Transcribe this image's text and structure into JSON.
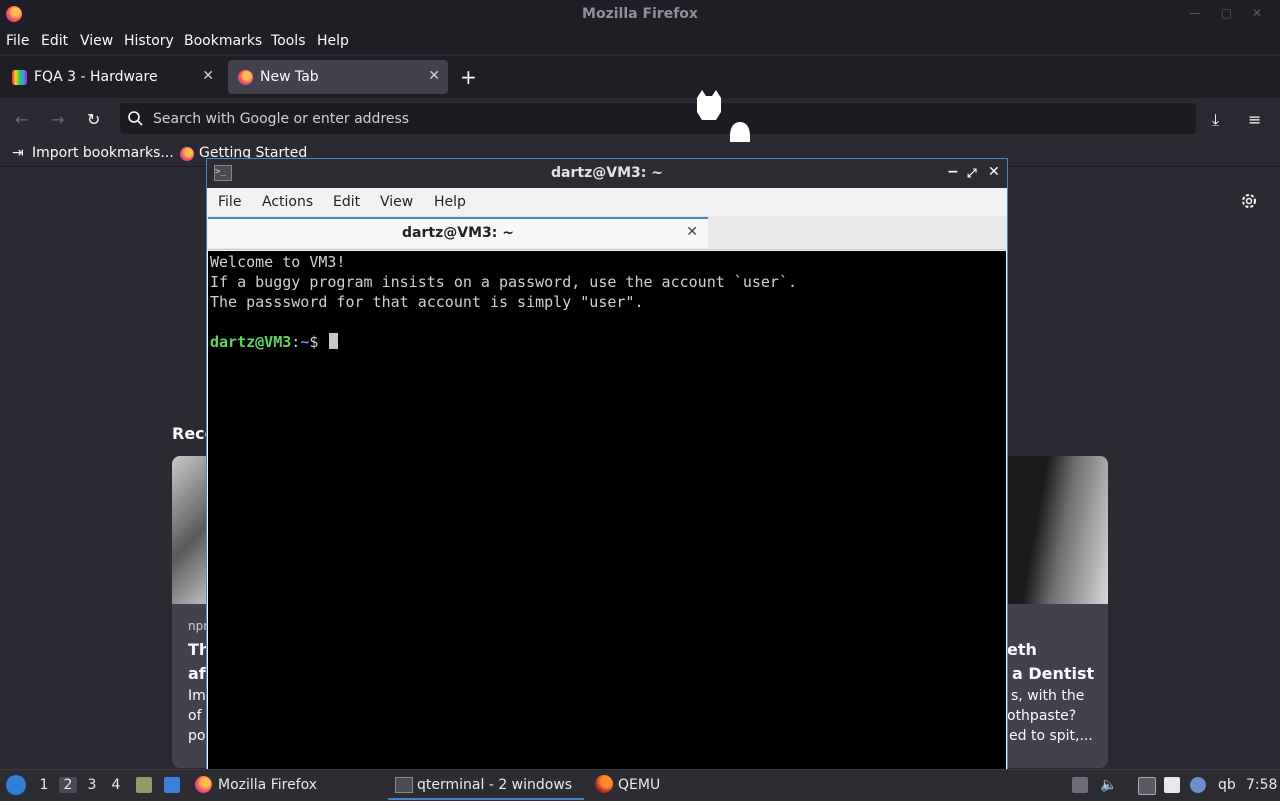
{
  "firefox": {
    "window_title": "Mozilla Firefox",
    "menu": [
      "File",
      "Edit",
      "View",
      "History",
      "Bookmarks",
      "Tools",
      "Help"
    ],
    "tabs": [
      {
        "label": "FQA 3 - Hardware",
        "active": false
      },
      {
        "label": "New Tab",
        "active": true
      }
    ],
    "new_tab_symbol": "+",
    "address_placeholder": "Search with Google or enter address",
    "bookmarks": [
      "Import bookmarks...",
      "Getting Started"
    ],
    "newtab": {
      "recent_label": "Reco",
      "cards": [
        {
          "source": "npr",
          "title_lines": [
            "Th",
            "af"
          ],
          "excerpt_lines": [
            "Im",
            "of",
            "po"
          ]
        },
        {
          "source": "",
          "title_lines": [
            "eth",
            "a Dentist"
          ],
          "excerpt_lines": [
            "s, with the",
            "othpaste?",
            "ed to spit,..."
          ]
        }
      ]
    },
    "colors": {
      "chrome": "#1f1e25",
      "content": "#2b2a33",
      "urlbar": "#1c1b22"
    }
  },
  "terminal": {
    "title": "dartz@VM3: ~",
    "menu": [
      "File",
      "Actions",
      "Edit",
      "View",
      "Help"
    ],
    "tab_label": "dartz@VM3: ~",
    "lines": [
      "Welcome to VM3!",
      "If a buggy program insists on a password, use the account `user`.",
      "The passsword for that account is simply \"user\"."
    ],
    "prompt": {
      "user_host": "dartz@VM3",
      "sep": ":",
      "path": "~",
      "symbol": "$"
    },
    "colors": {
      "accent": "#4a82c3",
      "prompt_user": "#5fd75f",
      "prompt_path": "#5f87ff"
    }
  },
  "taskbar": {
    "workspaces": [
      "1",
      "2",
      "3",
      "4"
    ],
    "active_workspace": "2",
    "tasks": [
      {
        "label": "Mozilla Firefox",
        "icon": "firefox-icon"
      },
      {
        "label": "qterminal - 2 windows",
        "icon": "terminal-icon"
      },
      {
        "label": "QEMU",
        "icon": "qemu-icon"
      }
    ],
    "tray_text": "qb",
    "clock": "7:58"
  }
}
